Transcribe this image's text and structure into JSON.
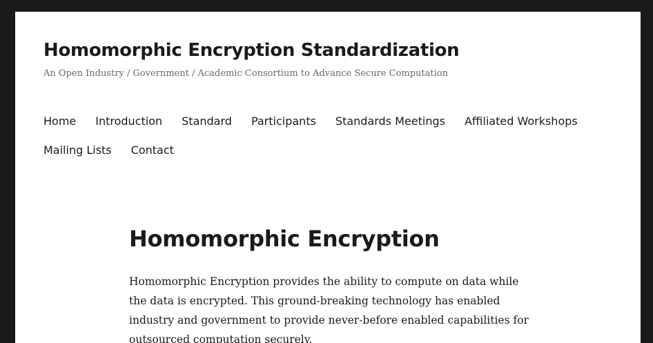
{
  "header": {
    "site_title": "Homomorphic Encryption Standardization",
    "tagline": "An Open Industry / Government / Academic Consortium to Advance Secure Computation"
  },
  "nav": {
    "row1": [
      {
        "label": "Home"
      },
      {
        "label": "Introduction"
      },
      {
        "label": "Standard"
      },
      {
        "label": "Participants"
      },
      {
        "label": "Standards Meetings"
      },
      {
        "label": "Affiliated Workshops"
      }
    ],
    "row2": [
      {
        "label": "Mailing Lists"
      },
      {
        "label": "Contact"
      }
    ]
  },
  "article": {
    "title": "Homomorphic Encryption",
    "body": "Homomorphic Encryption provides the ability to compute on data while the data is encrypted.  This ground-breaking technology has enabled industry and government to provide never-before enabled capabilities for outsourced computation securely."
  }
}
